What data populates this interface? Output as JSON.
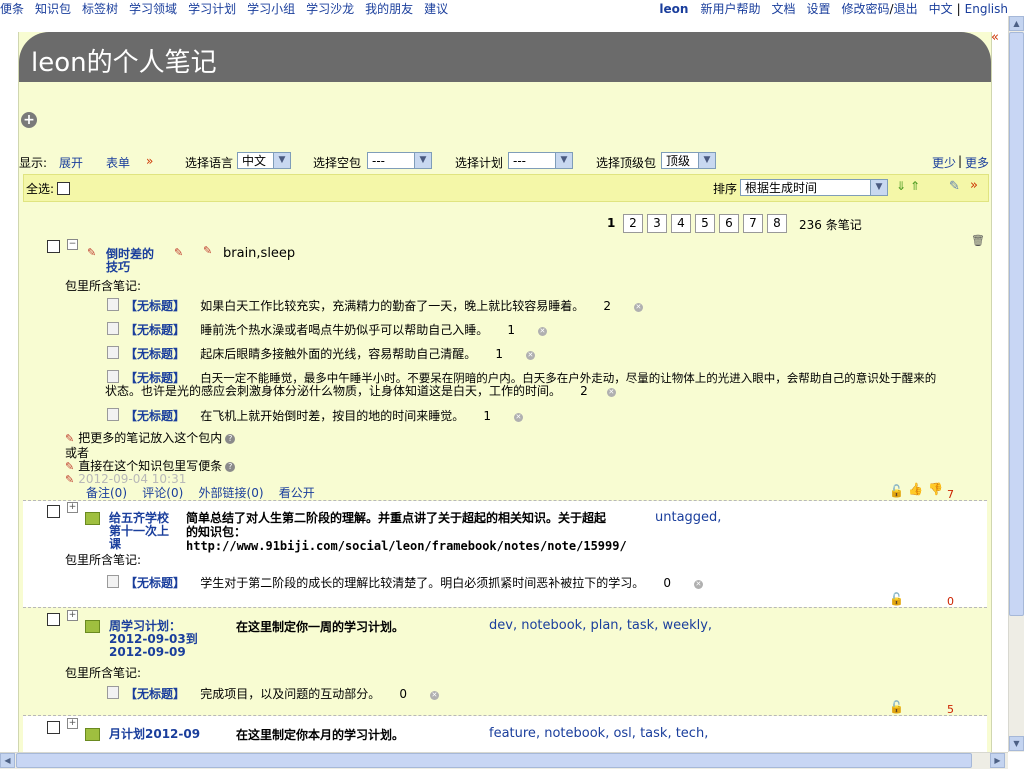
{
  "nav": {
    "items": [
      "便条",
      "知识包",
      "标签树",
      "学习领域",
      "学习计划",
      "学习小组",
      "学习沙龙",
      "我的朋友",
      "建议"
    ],
    "user": "leon",
    "right_items": [
      "新用户帮助",
      "文档",
      "设置"
    ],
    "change_password": "修改密码",
    "logout": "退出",
    "lang_cn": "中文",
    "lang_en": "English",
    "collapse": "«"
  },
  "page": {
    "title": "leon的个人笔记"
  },
  "filters": {
    "display_label": "显示:",
    "expand": "展开",
    "form": "表单",
    "form_arrow": "»",
    "language_label": "选择语言",
    "language_value": "中文",
    "space_label": "选择空包",
    "space_value": "---",
    "plan_label": "选择计划",
    "plan_value": "---",
    "top_label": "选择顶级包",
    "top_value": "顶级",
    "less": "更少",
    "more": "更多"
  },
  "list_header": {
    "select_all": "全选:",
    "sort_label": "排序",
    "sort_value": "根据生成时间",
    "expand_arrow": "»"
  },
  "pager": {
    "current": "1",
    "pages": [
      "2",
      "3",
      "4",
      "5",
      "6",
      "7",
      "8"
    ],
    "total": "236 条笔记"
  },
  "notes": [
    {
      "title_line1": "倒时差的",
      "title_line2": "技巧",
      "tags": "brain,sleep",
      "contained_label": "包里所含笔记:",
      "subs": [
        {
          "title": "【无标题】",
          "text": "如果白天工作比较充实，充满精力的勤奋了一天，晚上就比较容易睡着。",
          "count": "2"
        },
        {
          "title": "【无标题】",
          "text": "睡前洗个热水澡或者喝点牛奶似乎可以帮助自己入睡。",
          "count": "1"
        },
        {
          "title": "【无标题】",
          "text": "起床后眼睛多接触外面的光线，容易帮助自己清醒。",
          "count": "1"
        },
        {
          "title": "【无标题】",
          "text": "白天一定不能睡觉，最多中午睡半小时。不要呆在阴暗的户内。白天多在户外走动，尽量的让物体上的光进入眼中，会帮助自己的意识处于醒来的",
          "text2": "状态。也许是光的感应会刺激身体分泌什么物质，让身体知道这是白天，工作的时间。",
          "count": "2"
        },
        {
          "title": "【无标题】",
          "text": "在飞机上就开始倒时差，按目的地的时间来睡觉。",
          "count": "1"
        }
      ],
      "put_more": "把更多的笔记放入这个包内",
      "or": "或者",
      "write_direct": "直接在这个知识包里写便条",
      "timestamp": "2012-09-04 10:31",
      "links": [
        "备注(0)",
        "评论(0)",
        "外部链接(0)",
        "看公开"
      ],
      "votes": "7"
    },
    {
      "title_lines": [
        "给五齐学校",
        "第十一次上",
        "课"
      ],
      "desc_lines": [
        "简单总结了对人生第二阶段的理解。并重点讲了关于超起的相关知识。关于超起",
        "的知识包：",
        "http://www.91biji.com/social/leon/framebook/notes/note/15999/"
      ],
      "tags": "untagged,",
      "contained_label": "包里所含笔记:",
      "subs": [
        {
          "title": "【无标题】",
          "text": "学生对于第二阶段的成长的理解比较清楚了。明白必须抓紧时间恶补被拉下的学习。",
          "count": "0"
        }
      ],
      "votes": "0"
    },
    {
      "title_lines": [
        "周学习计划：",
        "2012-09-03到",
        "2012-09-09"
      ],
      "desc": "在这里制定你一周的学习计划。",
      "tags": [
        "dev",
        "notebook",
        "plan",
        "task",
        "weekly"
      ],
      "contained_label": "包里所含笔记:",
      "subs": [
        {
          "title": "【无标题】",
          "text": "完成项目，以及问题的互动部分。",
          "count": "0"
        }
      ],
      "votes": "5"
    },
    {
      "title": "月计划2012-09",
      "desc": "在这里制定你本月的学习计划。",
      "tags": [
        "feature",
        "notebook",
        "osl",
        "task",
        "tech"
      ]
    }
  ],
  "colors": {
    "link": "#1a3e9c",
    "panel_bg": "#f8fcd2",
    "title_bar": "#6b6b6b",
    "accent_red": "#cc2200"
  }
}
